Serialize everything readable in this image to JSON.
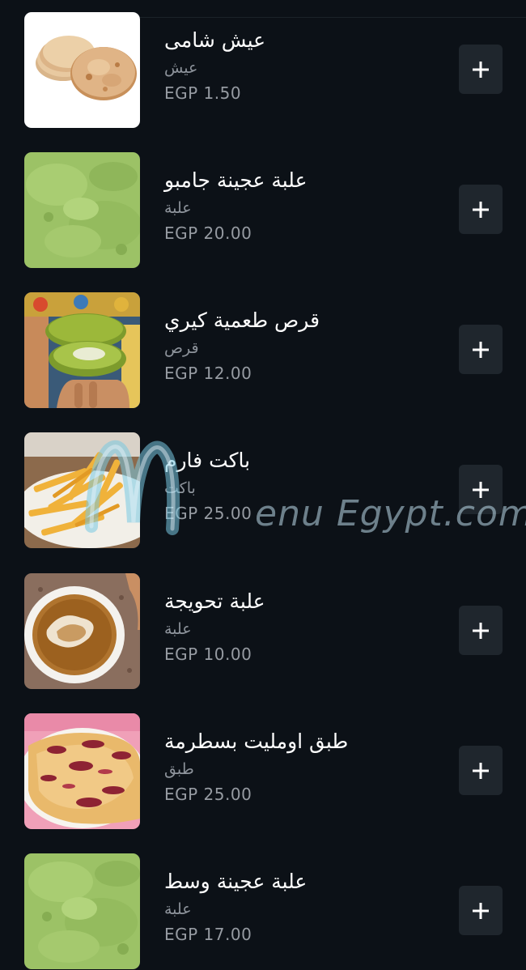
{
  "currency_prefix": "EGP",
  "watermark": "enu Egypt.com",
  "items": [
    {
      "name": "عيش شامى",
      "unit": "عيش",
      "price": "EGP 1.50",
      "image": "bread"
    },
    {
      "name": "علبة عجينة جامبو",
      "unit": "علبة",
      "price": "EGP 20.00",
      "image": "green-paste"
    },
    {
      "name": "قرص طعمية كيري",
      "unit": "قرص",
      "price": "EGP 12.00",
      "image": "falafel"
    },
    {
      "name": "باكت فارم",
      "unit": "باكت",
      "price": "EGP 25.00",
      "image": "fries"
    },
    {
      "name": "علبة تحويجة",
      "unit": "علبة",
      "price": "EGP 10.00",
      "image": "sauce-bowl"
    },
    {
      "name": "طبق اومليت بسطرمة",
      "unit": "طبق",
      "price": "EGP 25.00",
      "image": "omelette"
    },
    {
      "name": "علبة عجينة وسط",
      "unit": "علبة",
      "price": "EGP 17.00",
      "image": "green-paste"
    }
  ],
  "add_icon": "plus-icon",
  "colors": {
    "background": "#0c1117",
    "button": "#1f262d",
    "text": "#ffffff",
    "muted": "#8d939b"
  }
}
